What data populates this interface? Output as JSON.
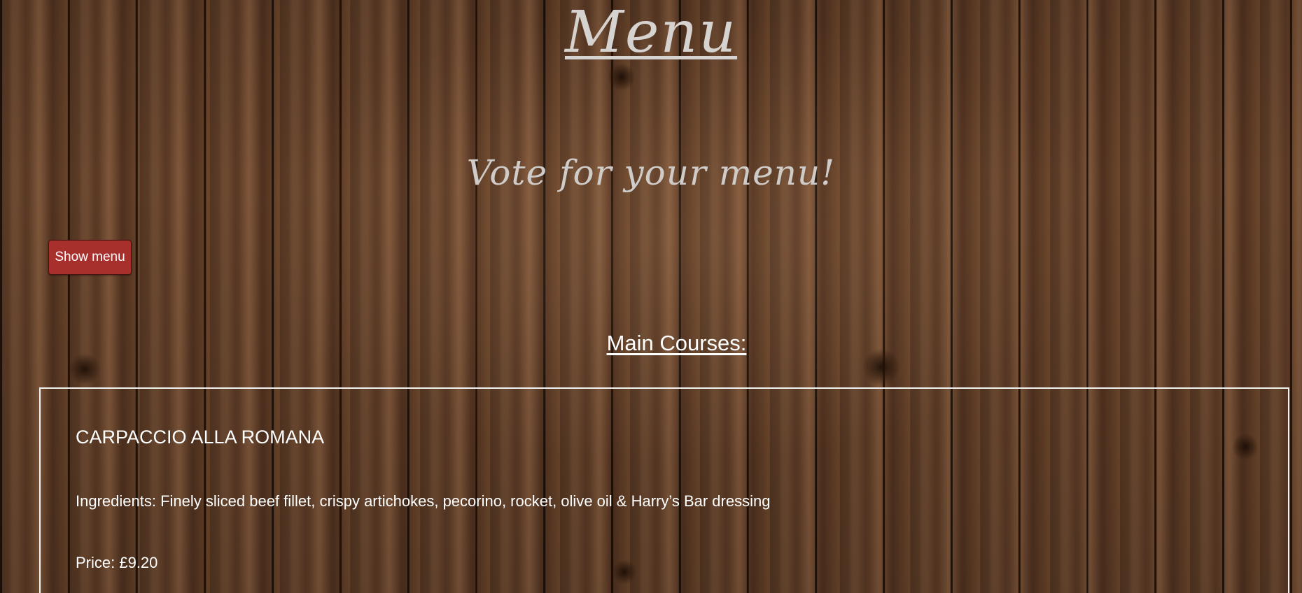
{
  "header": {
    "title": "Menu",
    "subtitle": "Vote for your menu!"
  },
  "controls": {
    "show_menu_label": "Show menu"
  },
  "section": {
    "heading": "Main Courses:"
  },
  "dishes": [
    {
      "name": "CARPACCIO ALLA ROMANA",
      "ingredients": "Ingredients: Finely sliced beef fillet, crispy artichokes, pecorino, rocket, olive oil & Harry’s Bar dressing",
      "price": "Price: £9.20"
    }
  ],
  "colors": {
    "button_background": "#a8302c",
    "title_text": "#d6d2cf",
    "body_text": "#ffffff",
    "card_border": "#f2f2f2"
  }
}
